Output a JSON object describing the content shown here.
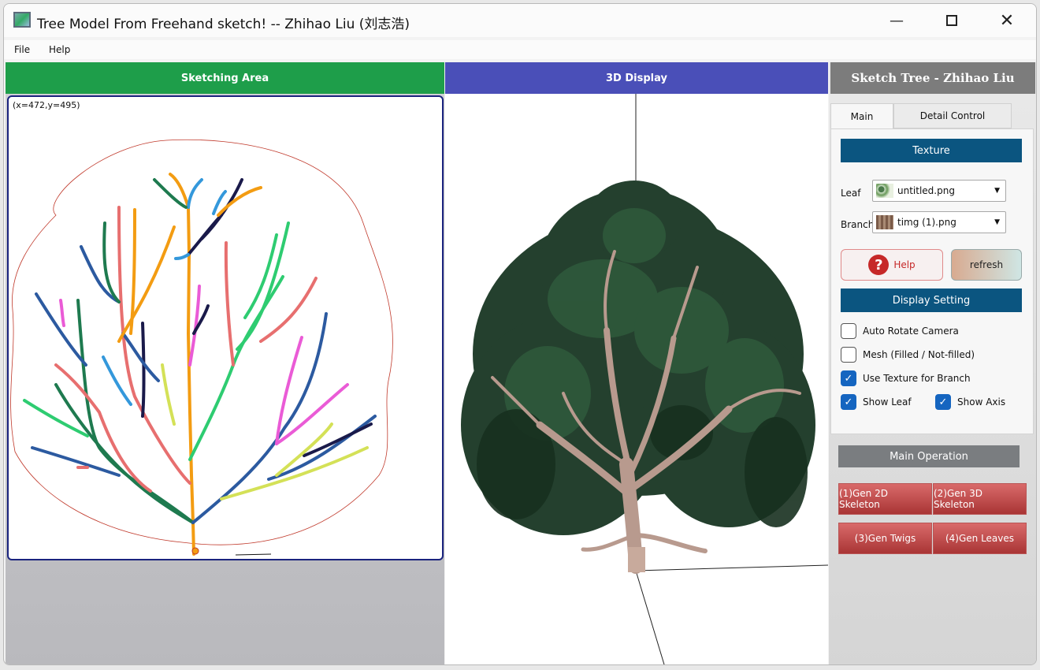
{
  "window": {
    "title": "Tree Model From Freehand sketch! -- Zhihao Liu (刘志浩)",
    "controls": [
      "minimize",
      "maximize",
      "close"
    ]
  },
  "menu": {
    "items": [
      "File",
      "Help"
    ]
  },
  "sketch": {
    "header": "Sketching Area",
    "header_color": "#1e9e4a",
    "coords": "(x=472,y=495)"
  },
  "display": {
    "header": "3D Display",
    "header_color": "#4a4fb8"
  },
  "panel": {
    "title": "Sketch Tree - Zhihao Liu",
    "tabs": [
      "Main",
      "Detail Control"
    ],
    "active_tab": "Main",
    "texture": {
      "header": "Texture",
      "leaf_label": "Leaf",
      "leaf_value": "untitled.png",
      "branch_label": "Branch",
      "branch_value": "timg (1).png"
    },
    "help_label": "Help",
    "refresh_label": "refresh",
    "display_setting": {
      "header": "Display Setting",
      "options": [
        {
          "label": "Auto Rotate Camera",
          "checked": false
        },
        {
          "label": "Mesh (Filled / Not-filled)",
          "checked": false
        },
        {
          "label": "Use Texture for Branch",
          "checked": true
        },
        {
          "label": "Show Leaf",
          "checked": true
        },
        {
          "label": "Show Axis",
          "checked": true
        }
      ]
    },
    "main_operation": {
      "header": "Main Operation",
      "buttons": [
        "(1)Gen 2D Skeleton",
        "(2)Gen 3D Skeleton",
        "(3)Gen Twigs",
        "(4)Gen Leaves"
      ]
    }
  }
}
